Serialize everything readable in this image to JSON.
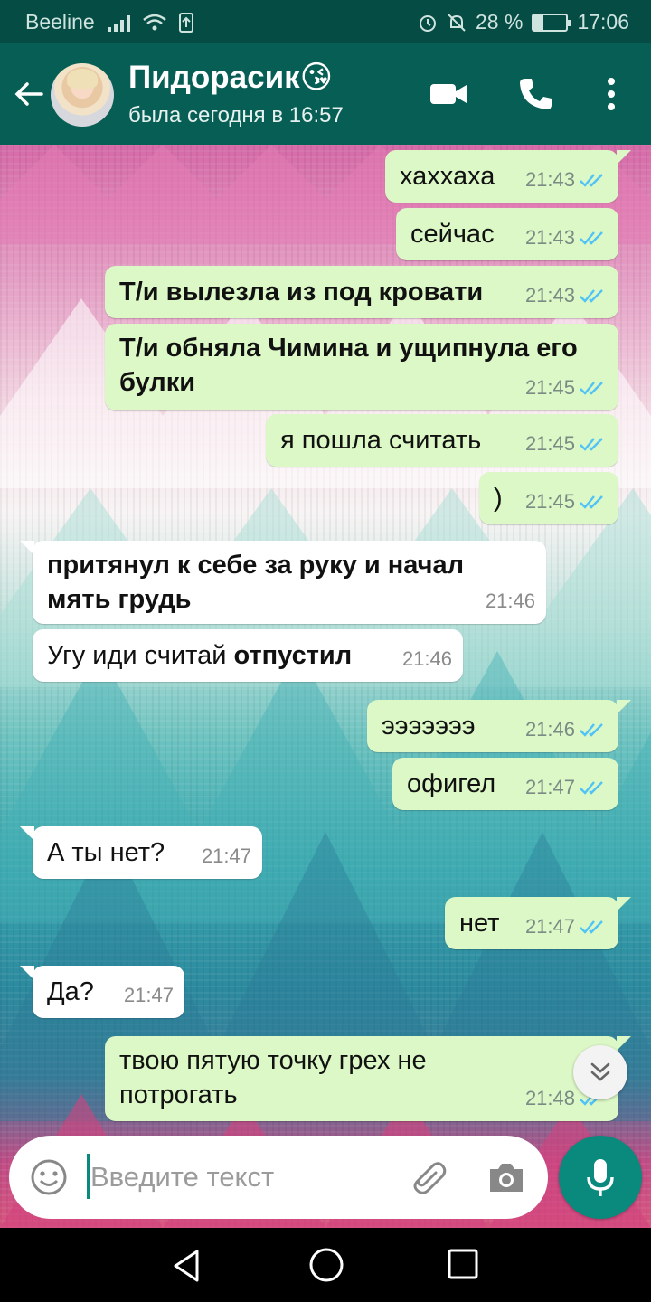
{
  "status_bar": {
    "carrier": "Beeline",
    "battery": "28 %",
    "battery_level": 0.28,
    "time": "17:06"
  },
  "header": {
    "contact_name": "Пидорасик😘",
    "last_seen": "была сегодня в 16:57"
  },
  "messages": [
    {
      "direction": "out",
      "text": "хаххаха",
      "time": "21:43",
      "bold": false
    },
    {
      "direction": "out",
      "text": "сейчас",
      "time": "21:43",
      "bold": false
    },
    {
      "direction": "out",
      "text": "Т/и вылезла из под кровати",
      "time": "21:43",
      "bold": true
    },
    {
      "direction": "out",
      "text_line1": "Т/и обняла Чимина и ущипнула его",
      "text_line2": "булки",
      "time": "21:45",
      "bold": true
    },
    {
      "direction": "out",
      "text": "я пошла считать",
      "time": "21:45",
      "bold": false
    },
    {
      "direction": "out",
      "text": ")",
      "time": "21:45",
      "bold": false
    },
    {
      "direction": "in",
      "text_line1": "притянул к себе за руку и начал",
      "text_line2": "мять грудь",
      "time": "21:46",
      "bold": true
    },
    {
      "direction": "in",
      "text_plain": "Угу иди считай ",
      "text_bold": "отпустил",
      "time": "21:46"
    },
    {
      "direction": "out",
      "text": "эээээээ",
      "time": "21:46",
      "bold": false
    },
    {
      "direction": "out",
      "text": "офигел",
      "time": "21:47",
      "bold": false
    },
    {
      "direction": "in",
      "text": "А ты нет?",
      "time": "21:47",
      "bold": false
    },
    {
      "direction": "out",
      "text": "нет",
      "time": "21:47",
      "bold": false
    },
    {
      "direction": "in",
      "text": "Да?",
      "time": "21:47",
      "bold": false
    },
    {
      "direction": "out",
      "text_line1": "твою пятую точку грех не",
      "text_line2": "потрогать",
      "time": "21:48",
      "bold": false
    }
  ],
  "input": {
    "placeholder": "Введите текст",
    "value": ""
  },
  "colors": {
    "header": "#075e54",
    "status_bar": "#054d44",
    "outgoing_bubble": "#dcf8c6",
    "incoming_bubble": "#ffffff",
    "accent": "#0a8a7c",
    "read_ticks": "#4fc3f7"
  },
  "icons": [
    "back-arrow-icon",
    "video-call-icon",
    "phone-icon",
    "more-vert-icon",
    "emoji-icon",
    "attach-icon",
    "camera-icon",
    "mic-icon",
    "scroll-down-icon",
    "read-ticks-icon"
  ]
}
